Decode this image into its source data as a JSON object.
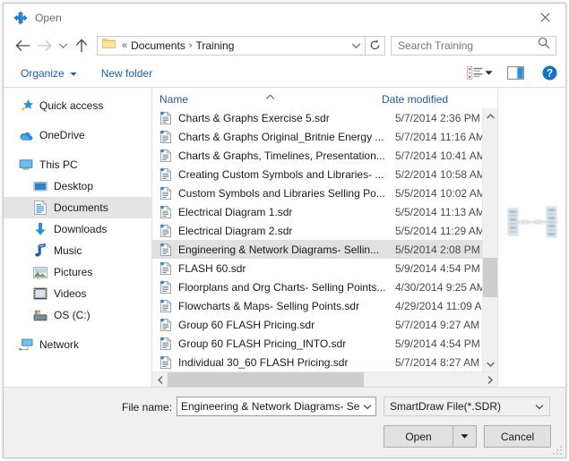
{
  "window": {
    "title": "Open",
    "app_icon": "smartdraw-diamond-icon",
    "close_label": "✕"
  },
  "address": {
    "back_icon": "back-arrow-icon",
    "forward_icon": "forward-arrow-icon",
    "recent_icon": "chevron-down-icon",
    "up_icon": "up-arrow-icon",
    "folder_icon": "folder-icon",
    "overflow": "«",
    "crumbs": [
      "Documents",
      "Training"
    ],
    "separator": "›",
    "dropdown_icon": "chevron-down-icon",
    "refresh_icon": "refresh-icon"
  },
  "search": {
    "placeholder": "Search Training",
    "icon": "search-icon"
  },
  "commandbar": {
    "organize_label": "Organize",
    "organize_caret": "▼",
    "new_folder_label": "New folder",
    "view_icon": "view-layout-icon",
    "view_caret": "▼",
    "preview_pane_icon": "preview-pane-icon",
    "help_icon": "help-icon"
  },
  "navpane": {
    "items": [
      {
        "label": "Quick access",
        "icon": "quick-access-star-icon",
        "level": 0,
        "selected": false
      },
      {
        "label": "OneDrive",
        "icon": "onedrive-cloud-icon",
        "level": 0,
        "selected": false
      },
      {
        "label": "This PC",
        "icon": "this-pc-monitor-icon",
        "level": 0,
        "selected": false
      },
      {
        "label": "Desktop",
        "icon": "desktop-icon",
        "level": 1,
        "selected": false
      },
      {
        "label": "Documents",
        "icon": "documents-icon",
        "level": 1,
        "selected": true
      },
      {
        "label": "Downloads",
        "icon": "downloads-arrow-icon",
        "level": 1,
        "selected": false
      },
      {
        "label": "Music",
        "icon": "music-note-icon",
        "level": 1,
        "selected": false
      },
      {
        "label": "Pictures",
        "icon": "pictures-icon",
        "level": 1,
        "selected": false
      },
      {
        "label": "Videos",
        "icon": "videos-icon",
        "level": 1,
        "selected": false
      },
      {
        "label": "OS (C:)",
        "icon": "disk-drive-icon",
        "level": 1,
        "selected": false
      },
      {
        "label": "Network",
        "icon": "network-icon",
        "level": 0,
        "selected": false
      }
    ]
  },
  "filelist": {
    "columns": {
      "name": "Name",
      "date": "Date modified"
    },
    "sort_indicator": "ascending-caret-icon",
    "rows": [
      {
        "name": "Charts & Graphs Exercise 5.sdr",
        "date": "5/7/2014 2:36 PM",
        "icon": "sdr-file-icon",
        "selected": false
      },
      {
        "name": "Charts & Graphs Original_Britnie Energy ...",
        "date": "5/7/2014 11:16 AM",
        "icon": "sdr-file-icon",
        "selected": false
      },
      {
        "name": "Charts & Graphs, Timelines, Presentation...",
        "date": "5/7/2014 10:41 AM",
        "icon": "sdr-file-icon",
        "selected": false
      },
      {
        "name": "Creating Custom Symbols and Libraries- ...",
        "date": "5/2/2014 10:58 AM",
        "icon": "sdr-file-icon",
        "selected": false
      },
      {
        "name": "Custom Symbols and Libraries Selling Po...",
        "date": "5/5/2014 10:02 AM",
        "icon": "sdr-file-icon",
        "selected": false
      },
      {
        "name": "Electrical Diagram 1.sdr",
        "date": "5/5/2014 11:13 AM",
        "icon": "sdr-file-icon",
        "selected": false
      },
      {
        "name": "Electrical Diagram 2.sdr",
        "date": "5/5/2014 11:29 AM",
        "icon": "sdr-file-icon",
        "selected": false
      },
      {
        "name": "Engineering & Network Diagrams- Sellin...",
        "date": "5/5/2014 2:08 PM",
        "icon": "sdr-file-icon",
        "selected": true
      },
      {
        "name": "FLASH 60.sdr",
        "date": "5/9/2014 4:54 PM",
        "icon": "sdr-file-icon",
        "selected": false
      },
      {
        "name": "Floorplans and Org Charts- Selling Points...",
        "date": "4/30/2014 9:25 AM",
        "icon": "sdr-file-icon",
        "selected": false
      },
      {
        "name": "Flowcharts & Maps- Selling Points.sdr",
        "date": "4/29/2014 11:09 AM",
        "icon": "sdr-file-icon",
        "selected": false
      },
      {
        "name": "Group 60 FLASH Pricing.sdr",
        "date": "5/7/2014 9:27 AM",
        "icon": "sdr-file-icon",
        "selected": false
      },
      {
        "name": "Group 60 FLASH Pricing_INTO.sdr",
        "date": "5/9/2014 4:54 PM",
        "icon": "sdr-file-icon",
        "selected": false
      },
      {
        "name": "Individual 30_60 FLASH Pricing.sdr",
        "date": "5/7/2014 8:27 AM",
        "icon": "sdr-file-icon",
        "selected": false
      }
    ]
  },
  "scrollbars": {
    "up_icon": "scroll-up-icon",
    "down_icon": "scroll-down-icon",
    "left_icon": "scroll-left-icon",
    "right_icon": "scroll-right-icon"
  },
  "preview": {
    "thumbnail": "network-diagram-thumbnail"
  },
  "footer": {
    "filename_label": "File name:",
    "filename_value": "Engineering & Network Diagrams- Se",
    "filetype_value": "SmartDraw File(*.SDR)",
    "open_label": "Open",
    "open_split_caret": "▼",
    "cancel_label": "Cancel",
    "combo_caret": "⌄"
  },
  "colors": {
    "accent_blue": "#1d5b9e",
    "header_blue": "#2b5797",
    "selection_gray": "#e1e1e1",
    "nav_selection_gray": "#e4e4e4",
    "help_blue": "#1673c0",
    "folder_yellow": "#fbd579"
  }
}
